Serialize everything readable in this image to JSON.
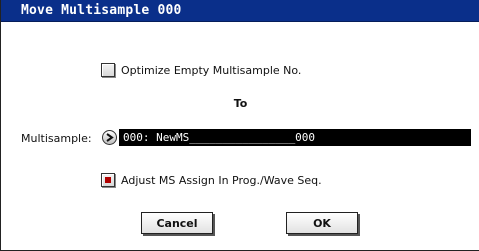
{
  "window": {
    "title": "Move Multisample 000"
  },
  "optimize": {
    "label": "Optimize Empty Multisample No.",
    "checked": false
  },
  "to_label": "To",
  "multisample": {
    "label": "Multisample:",
    "value": "000: NewMS________________000"
  },
  "adjust": {
    "label": "Adjust MS Assign In Prog./Wave Seq.",
    "checked": true
  },
  "buttons": {
    "cancel": "Cancel",
    "ok": "OK"
  },
  "colors": {
    "titlebar": "#0a2f8a",
    "checkmark": "#b00000",
    "field_bg": "#000000"
  }
}
